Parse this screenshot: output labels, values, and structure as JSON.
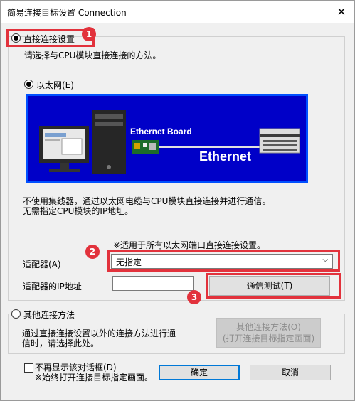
{
  "window": {
    "title": "简易连接目标设置 Connection",
    "close_glyph": "✕"
  },
  "direct": {
    "radio_label": "直接连接设置",
    "description": "请选择与CPU模块直接连接的方法。",
    "ethernet_label": "以太网(E)",
    "image": {
      "board_label": "Ethernet Board",
      "cable_label": "Ethernet",
      "background": "#0000c8",
      "frame": "#0050ff"
    },
    "note_line1": "不使用集线器，通过以太网电缆与CPU模块直接连接并进行通信。",
    "note_line2": "无需指定CPU模块的IP地址。",
    "note_all_ports": "※适用于所有以太网端口直接连接设置。",
    "adapter_label": "适配器(A)",
    "adapter_value": "无指定",
    "adapter_ip_label": "适配器的IP地址",
    "adapter_ip_value": "",
    "test_button": "通信测试(T)"
  },
  "other": {
    "radio_label": "其他连接方法",
    "description_line1": "通过直接连接设置以外的连接方法进行通",
    "description_line2": "信时，请选择此处。",
    "button_line1": "其他连接方法(O)",
    "button_line2": "(打开连接目标指定画面)"
  },
  "footer": {
    "checkbox_label": "不再显示该对话框(D)",
    "checkbox_note": "※始终打开连接目标指定画面。",
    "ok_button": "确定",
    "cancel_button": "取消"
  },
  "annotations": {
    "badge1": "1",
    "badge2": "2",
    "badge3": "3",
    "color": "#e2323c"
  }
}
